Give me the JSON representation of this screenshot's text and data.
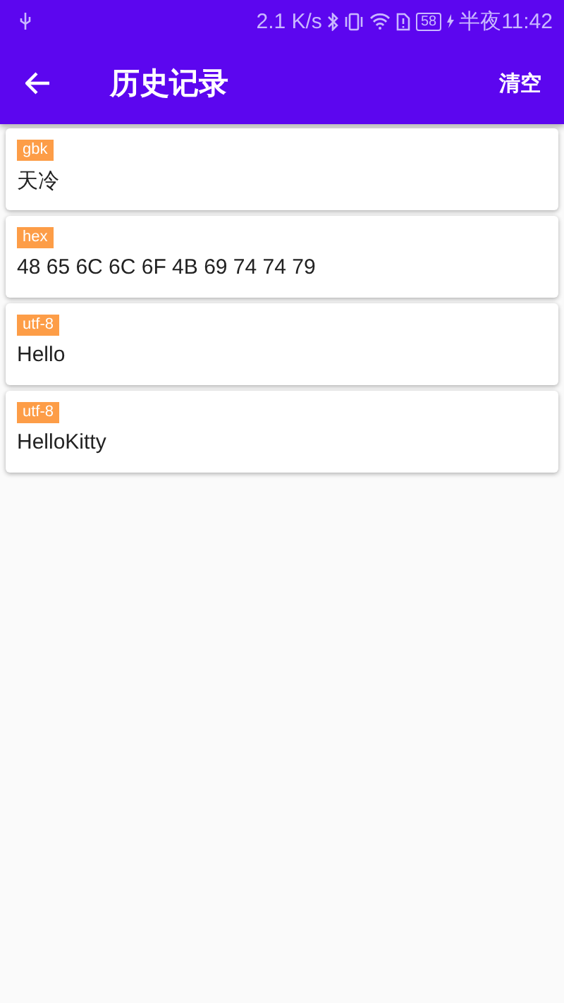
{
  "status_bar": {
    "speed": "2.1 K/s",
    "battery": "58",
    "time": "半夜11:42"
  },
  "app_bar": {
    "title": "历史记录",
    "action": "清空"
  },
  "records": [
    {
      "encoding": "gbk",
      "text": "天冷"
    },
    {
      "encoding": "hex",
      "text": "48 65 6C 6C 6F 4B 69 74 74 79"
    },
    {
      "encoding": "utf-8",
      "text": "Hello"
    },
    {
      "encoding": "utf-8",
      "text": "HelloKitty"
    }
  ]
}
